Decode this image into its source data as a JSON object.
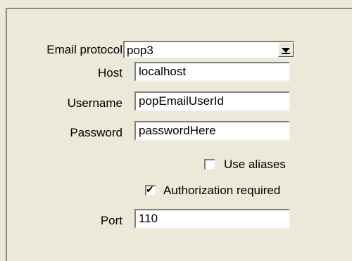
{
  "form": {
    "protocol_label": "Email protocol",
    "protocol_value": "pop3",
    "host_label": "Host",
    "host_value": "localhost",
    "username_label": "Username",
    "username_value": "popEmailUserId",
    "password_label": "Password",
    "password_value": "passwordHere",
    "use_aliases_label": "Use aliases",
    "use_aliases_checked": false,
    "auth_required_label": "Authorization required",
    "auth_required_checked": true,
    "port_label": "Port",
    "port_value": "110"
  },
  "icons": {
    "dropdown": "chevron-down-icon",
    "check": "check-icon"
  }
}
